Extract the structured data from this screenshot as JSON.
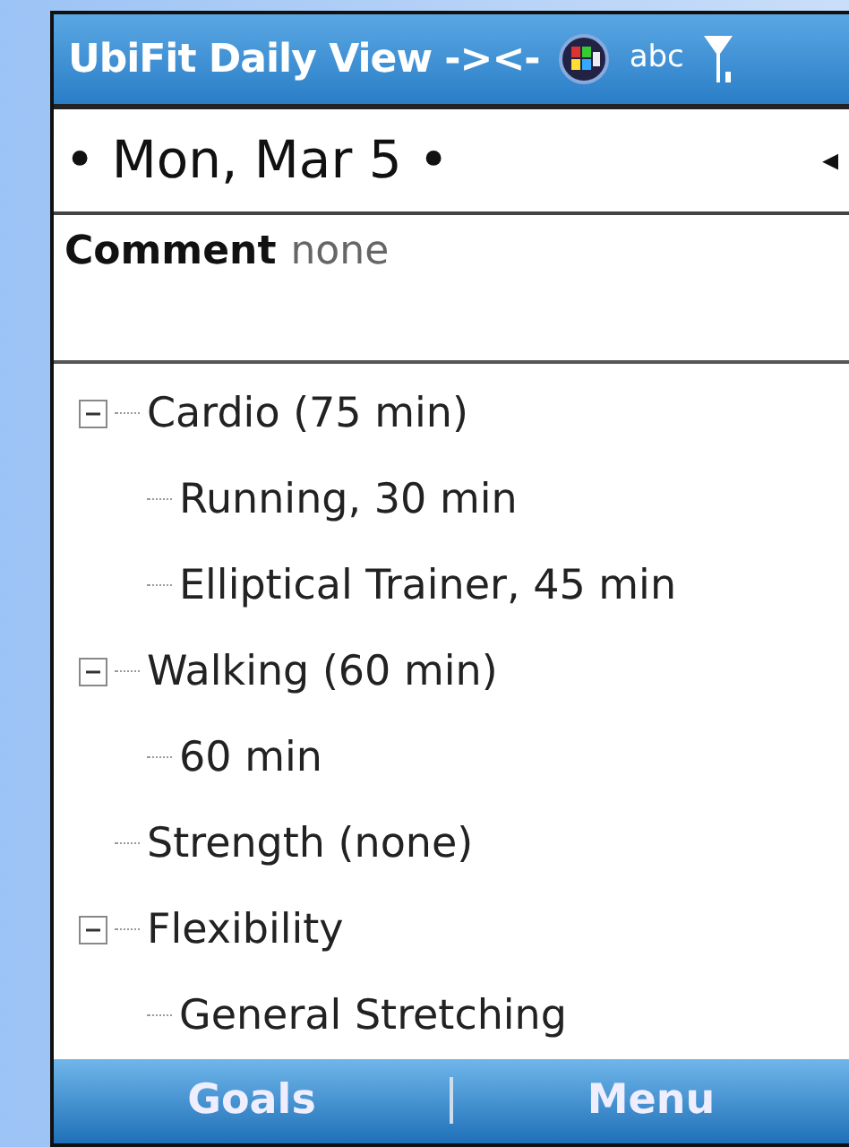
{
  "title_bar": {
    "title": "UbiFit Daily View -><-",
    "input_mode": "abc"
  },
  "date_row": {
    "date": "• Mon, Mar 5 •",
    "arrow": "◂"
  },
  "comment": {
    "label": "Comment",
    "value": "none"
  },
  "tree": [
    {
      "label": "Cardio (75 min)",
      "expanded": true,
      "children": [
        {
          "label": "Running, 30 min"
        },
        {
          "label": "Elliptical Trainer, 45 min"
        }
      ]
    },
    {
      "label": "Walking (60 min)",
      "expanded": true,
      "children": [
        {
          "label": "60 min"
        }
      ]
    },
    {
      "label": "Strength (none)"
    },
    {
      "label": "Flexibility",
      "expanded": true,
      "children": [
        {
          "label": "General Stretching"
        }
      ]
    }
  ],
  "softkeys": [
    "Goals",
    "Menu"
  ]
}
